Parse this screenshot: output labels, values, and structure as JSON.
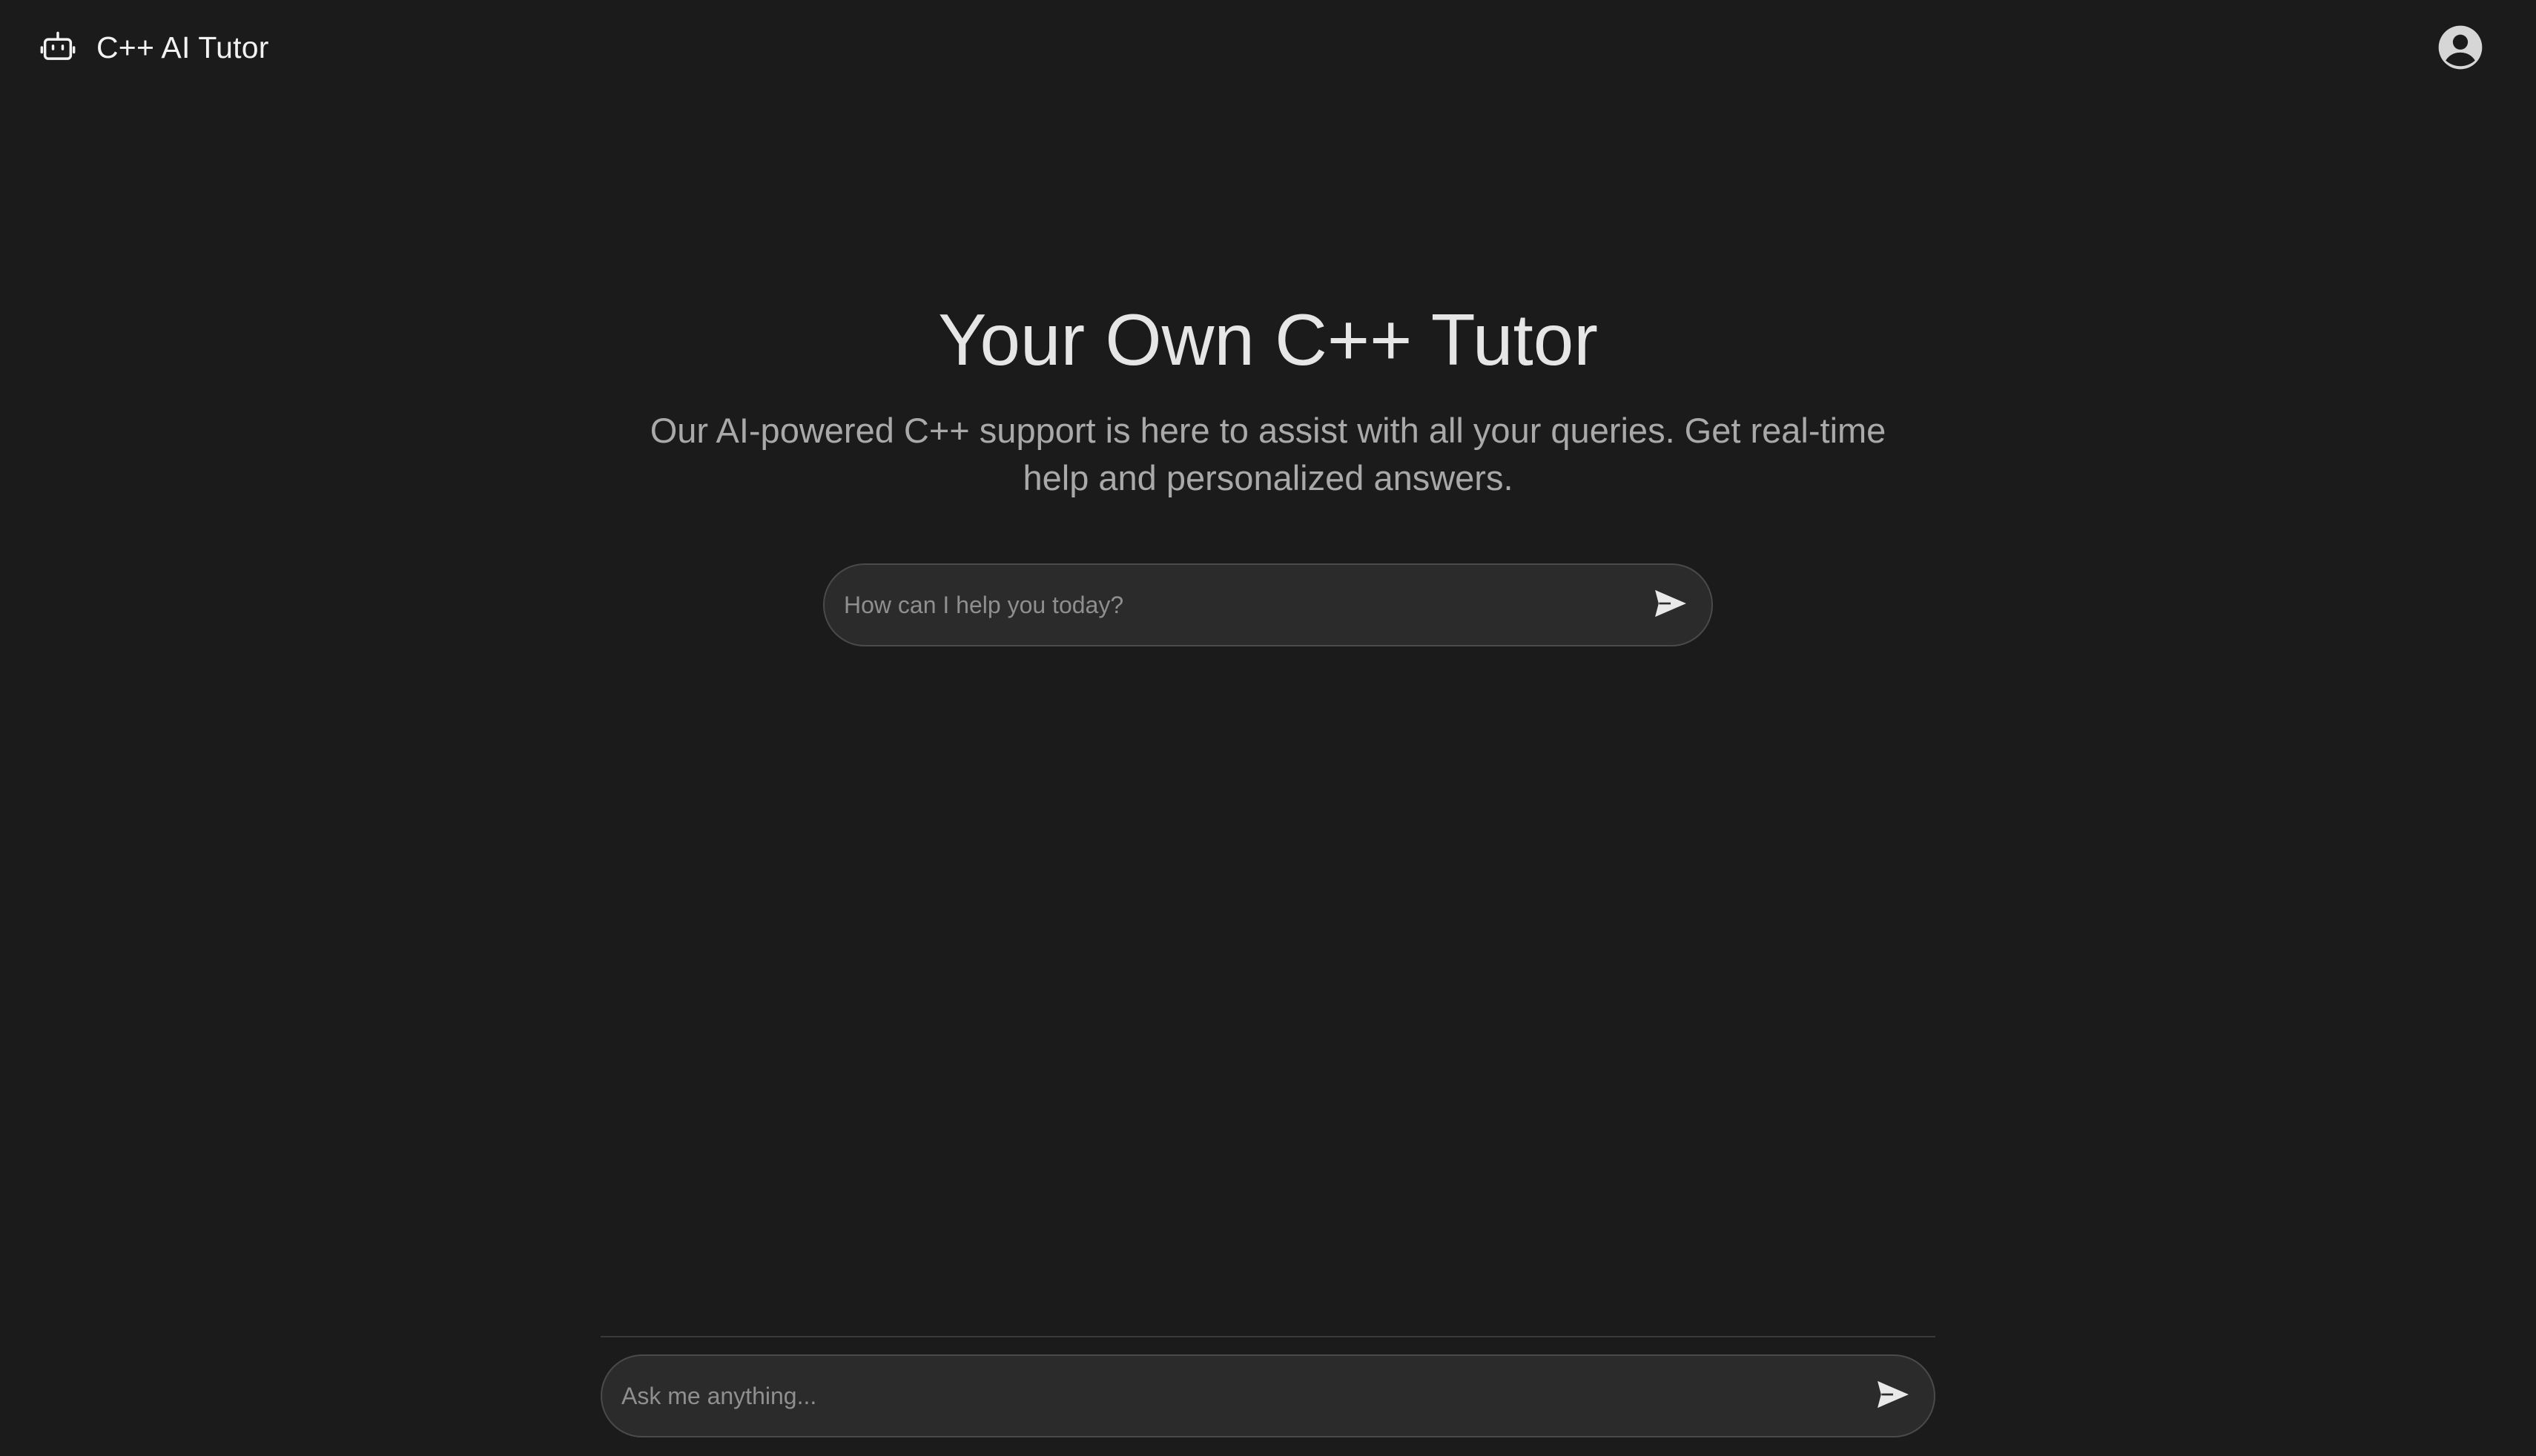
{
  "header": {
    "app_title": "C++ AI Tutor",
    "logo_icon": "robot-icon",
    "account_icon": "user-circle-icon"
  },
  "hero": {
    "title": "Your Own C++ Tutor",
    "subtitle": "Our AI-powered C++ support is here to assist with all your queries. Get real-time help and personalized answers.",
    "input_placeholder": "How can I help you today?",
    "input_value": "",
    "send_icon": "send-icon"
  },
  "footer": {
    "input_placeholder": "Ask me anything...",
    "input_value": "",
    "send_icon": "send-icon"
  },
  "colors": {
    "background": "#1b1b1b",
    "input_background": "#2b2b2b",
    "input_border": "#4a4a4a",
    "text_primary": "#e6e6e6",
    "text_secondary": "#a9a9a9"
  }
}
